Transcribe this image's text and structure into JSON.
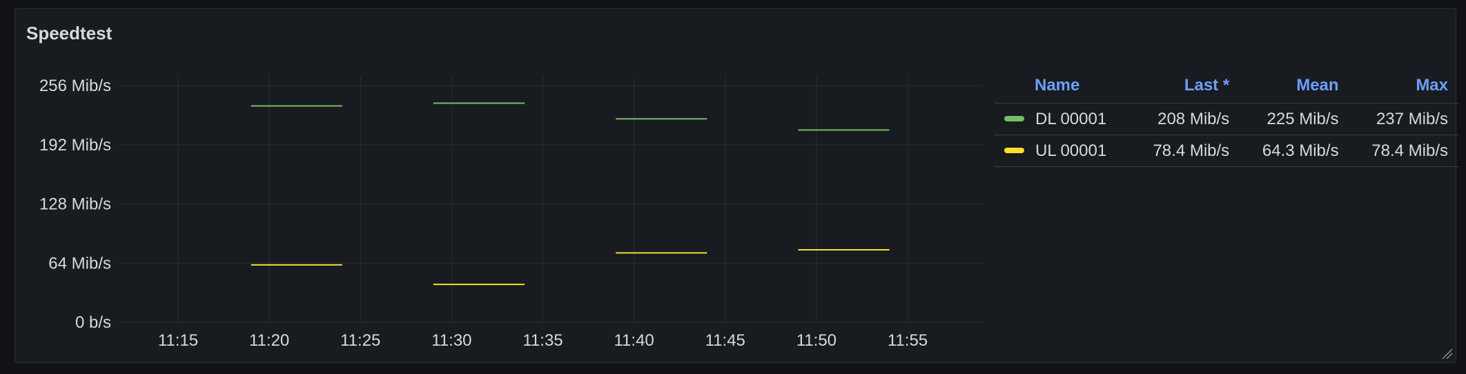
{
  "panel": {
    "title": "Speedtest"
  },
  "colors": {
    "background": "#181b1f",
    "grid": "#2a2d32",
    "axis_text": "#d8d9da",
    "legend_header": "#6e9fff",
    "dl": "#73bf69",
    "ul": "#fade2a"
  },
  "legend": {
    "headers": {
      "name": "Name",
      "last": "Last *",
      "mean": "Mean",
      "max": "Max"
    },
    "rows": [
      {
        "name": "DL 00001",
        "last": "208 Mib/s",
        "mean": "225 Mib/s",
        "max": "237 Mib/s",
        "color": "#73bf69"
      },
      {
        "name": "UL 00001",
        "last": "78.4 Mib/s",
        "mean": "64.3 Mib/s",
        "max": "78.4 Mib/s",
        "color": "#fade2a"
      }
    ]
  },
  "chart_data": {
    "type": "line",
    "title": "Speedtest",
    "xlabel": "",
    "ylabel": "",
    "grid": true,
    "legend_position": "right",
    "ylim": [
      0,
      256
    ],
    "yticks": [
      {
        "value": 256,
        "label": "256 Mib/s"
      },
      {
        "value": 192,
        "label": "192 Mib/s"
      },
      {
        "value": 128,
        "label": "128 Mib/s"
      },
      {
        "value": 64,
        "label": "64 Mib/s"
      },
      {
        "value": 0,
        "label": "0 b/s"
      }
    ],
    "xlim": [
      "11:05",
      "11:59"
    ],
    "xticks": [
      "11:15",
      "11:20",
      "11:25",
      "11:30",
      "11:35",
      "11:40",
      "11:45",
      "11:50",
      "11:55"
    ],
    "series": [
      {
        "name": "DL 00001",
        "color": "#73bf69",
        "segments": [
          {
            "start": "11:19",
            "end": "11:24",
            "value": 234
          },
          {
            "start": "11:29",
            "end": "11:34",
            "value": 237
          },
          {
            "start": "11:39",
            "end": "11:44",
            "value": 220
          },
          {
            "start": "11:49",
            "end": "11:54",
            "value": 208
          }
        ]
      },
      {
        "name": "UL 00001",
        "color": "#fade2a",
        "segments": [
          {
            "start": "11:19",
            "end": "11:24",
            "value": 62
          },
          {
            "start": "11:29",
            "end": "11:34",
            "value": 41
          },
          {
            "start": "11:39",
            "end": "11:44",
            "value": 75
          },
          {
            "start": "11:49",
            "end": "11:54",
            "value": 78.4
          }
        ]
      }
    ]
  }
}
